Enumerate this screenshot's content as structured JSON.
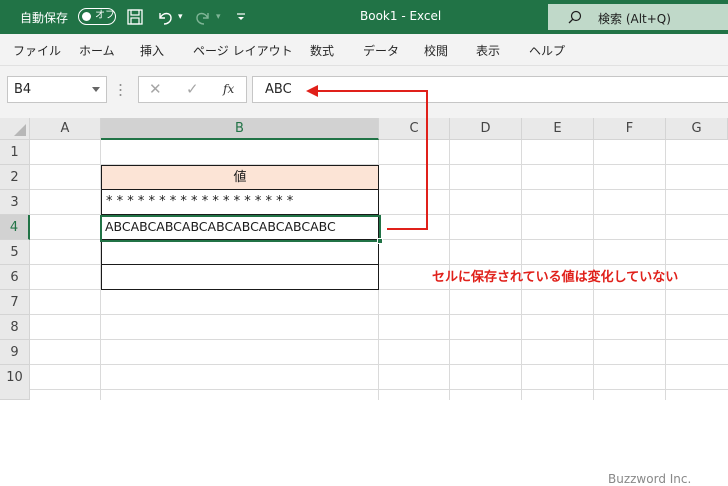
{
  "titlebar": {
    "autosave_label": "自動保存",
    "autosave_state": "オフ",
    "title": "Book1  -  Excel",
    "search_text": "検索 (Alt+Q)"
  },
  "ribbon": {
    "tabs": [
      "ファイル",
      "ホーム",
      "挿入",
      "ページ レイアウト",
      "数式",
      "データ",
      "校閲",
      "表示",
      "ヘルプ"
    ]
  },
  "formula_bar": {
    "name_box": "B4",
    "fx_label": "fx",
    "content": "ABC"
  },
  "grid": {
    "columns": [
      "A",
      "B",
      "C",
      "D",
      "E",
      "F",
      "G"
    ],
    "rows": [
      "1",
      "2",
      "3",
      "4",
      "5",
      "6",
      "7",
      "8",
      "9",
      "10"
    ],
    "selected_column": "B",
    "selected_row": "4"
  },
  "table": {
    "header": "値",
    "row3": "* * * * * * * * * * * * * * * * * *",
    "row4": "ABCABCABCABCABCABCABCABCABC"
  },
  "annotation": "セルに保存されている値は変化していない",
  "watermark": "Buzzword Inc.",
  "colors": {
    "excel_green": "#217346",
    "header_fill": "#fce4d6",
    "annotation_red": "#e0201a"
  }
}
